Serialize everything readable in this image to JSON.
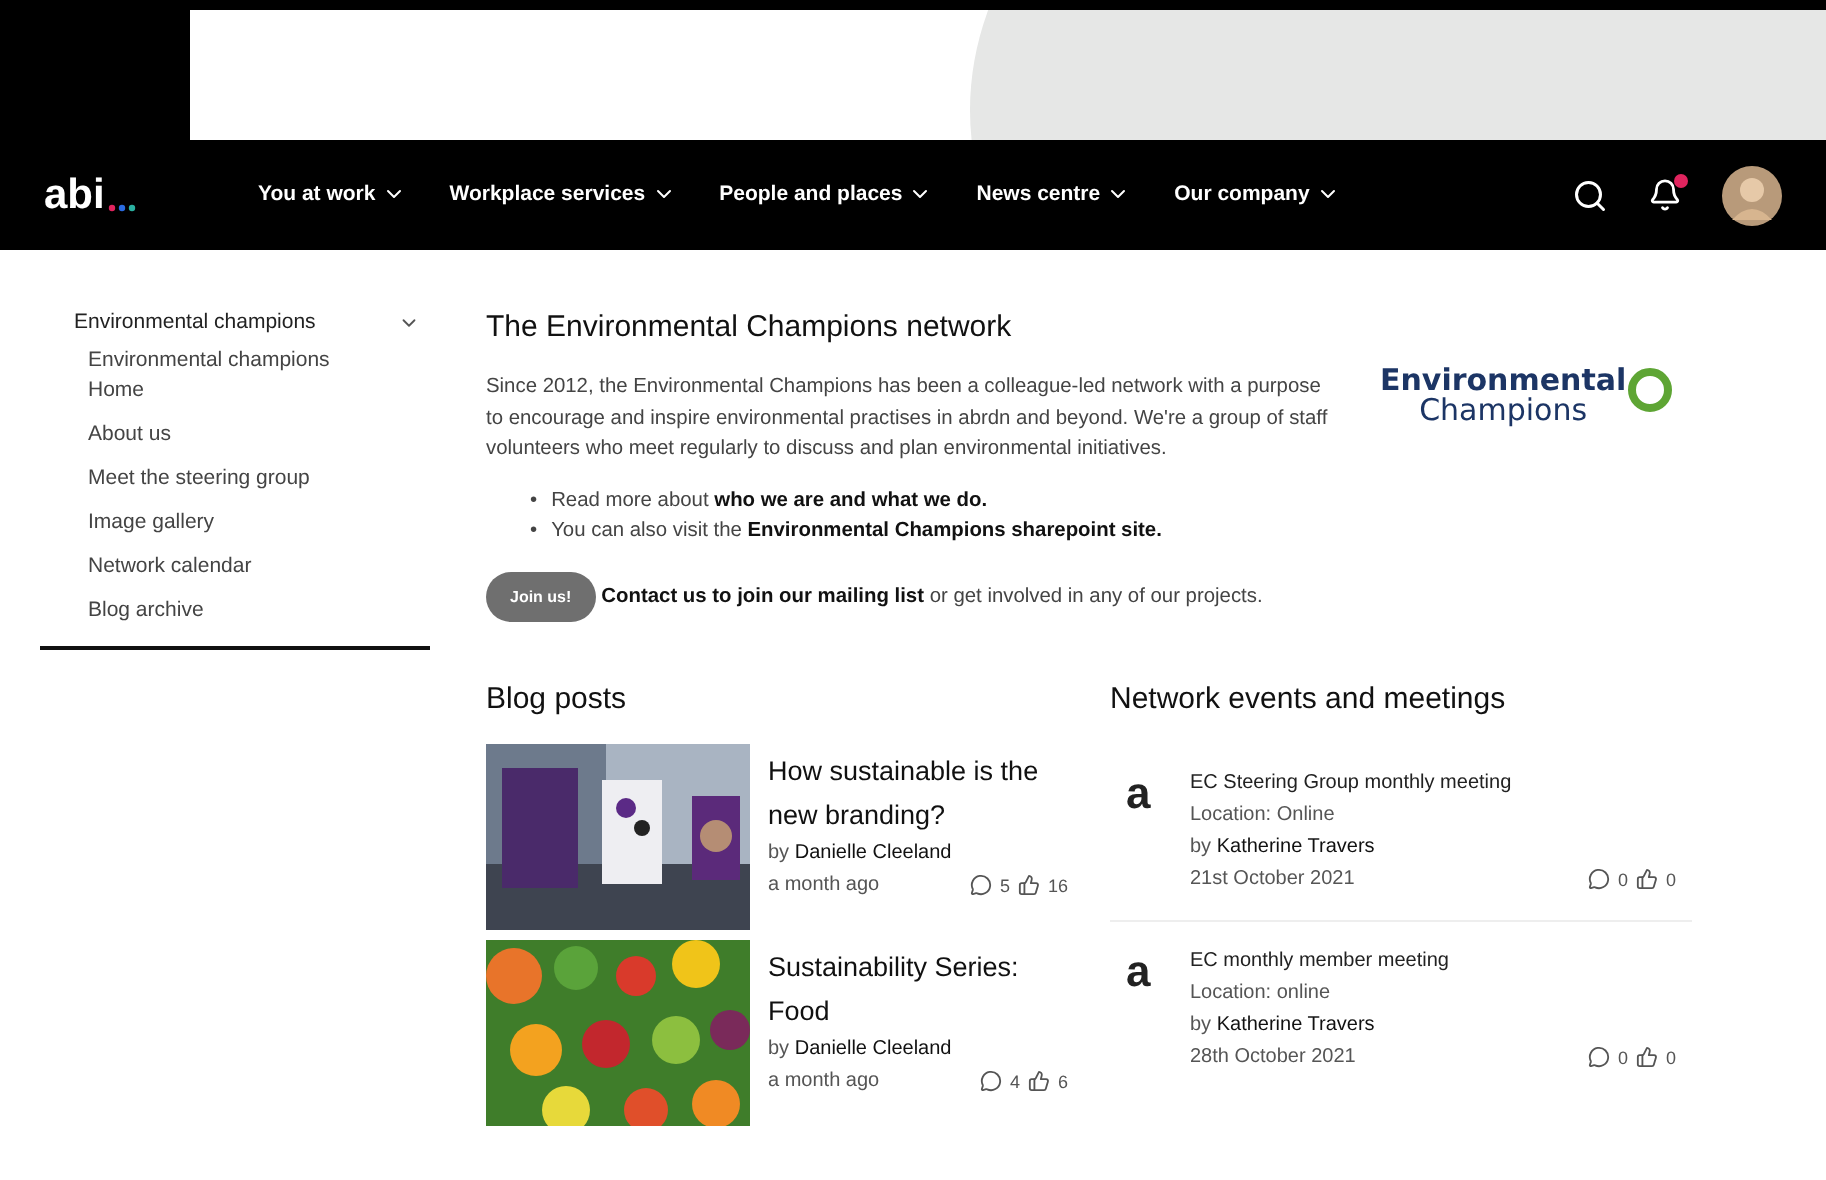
{
  "nav": {
    "logo": "abi",
    "items": [
      {
        "label": "You at work",
        "selected": false
      },
      {
        "label": "Workplace services",
        "selected": false
      },
      {
        "label": "People and places",
        "selected": false
      },
      {
        "label": "News centre",
        "selected": false
      },
      {
        "label": "Our company",
        "selected": false
      }
    ],
    "has_unread": true
  },
  "sidebar": {
    "title": "Environmental champions",
    "expanded": true,
    "items": [
      {
        "label": "Environmental champions Home"
      },
      {
        "label": "About us"
      },
      {
        "label": "Meet the steering group"
      },
      {
        "label": "Image gallery"
      },
      {
        "label": "Network calendar"
      },
      {
        "label": "Blog archive"
      }
    ]
  },
  "intro": {
    "title": "The Environmental Champions network",
    "paragraph": "Since 2012, the Environmental Champions has been a colleague-led network with a purpose to encourage and inspire environmental practises in abrdn and beyond. We're a group of staff volunteers who meet regularly to discuss and plan environmental initiatives.",
    "bullets": [
      {
        "marker": "•",
        "text": "Read more about **who we are and what we do.**"
      },
      {
        "marker": "•",
        "text": "You can also visit the **Environmental Champions sharepoint site.**"
      }
    ],
    "join_button": "Join us!",
    "join_text": "**Contact us to join our mailing list** or get involved in any of our projects.",
    "logo_line_1": "Environmental",
    "logo_line_2": "Champions"
  },
  "blog": {
    "title": "Blog posts",
    "posts": [
      {
        "title": "How sustainable is the new branding?",
        "byline": "by **Danielle Cleeland**",
        "time": "a month ago",
        "comments": "5",
        "likes": "16"
      },
      {
        "title": "Sustainability Series: Food",
        "byline": "by **Danielle Cleeland**",
        "time": "a month ago",
        "comments": "4",
        "likes": "6"
      }
    ]
  },
  "events": {
    "title": "Network events and meetings",
    "items": [
      {
        "logo": "a",
        "title": "EC Steering Group monthly meeting",
        "location": "Location: Online",
        "byline": "by **Katherine Travers**",
        "date": "21st October 2021",
        "comments": "0",
        "likes": "0"
      },
      {
        "logo": "a",
        "title": "EC monthly member meeting",
        "location": "Location: online",
        "byline": "by **Katherine Travers**",
        "date": "28th October 2021",
        "comments": "0",
        "likes": "0"
      }
    ]
  }
}
